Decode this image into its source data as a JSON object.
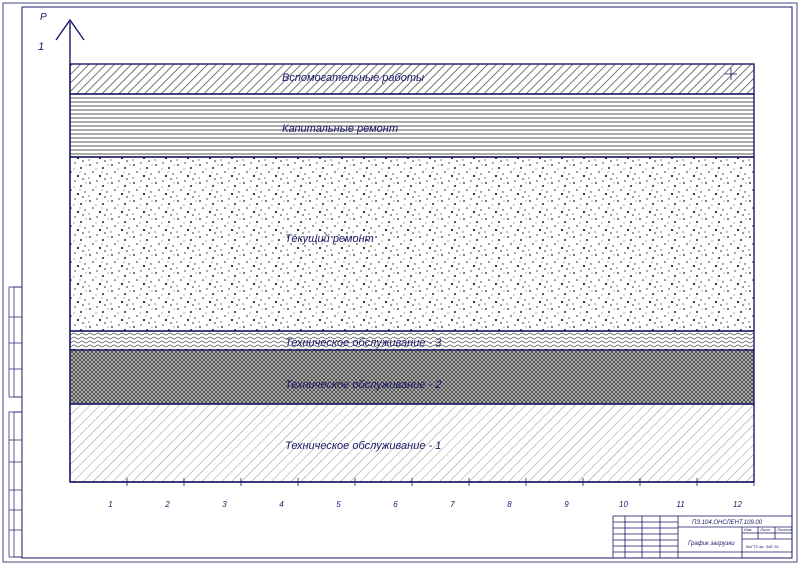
{
  "axis": {
    "y_symbol": "Р",
    "y_value": "1",
    "x_ticks": [
      "1",
      "2",
      "3",
      "4",
      "5",
      "6",
      "7",
      "8",
      "9",
      "10",
      "11",
      "12"
    ]
  },
  "bands": [
    {
      "label": "Вспомогательные работы",
      "pattern": "diag-dense"
    },
    {
      "label": "Капитальные ремонт",
      "pattern": "horizontal-lines"
    },
    {
      "label": "Текущий ремонт",
      "pattern": "speckle"
    },
    {
      "label": "Техническое обслуживание - 3",
      "pattern": "wavy"
    },
    {
      "label": "Техническое обслуживание - 2",
      "pattern": "crosshatch"
    },
    {
      "label": "Техническое обслуживание - 1",
      "pattern": "diag-sparse"
    }
  ],
  "title_block": {
    "doc_code": "ПЗ.104.ОНСЛЕНТ.109.00",
    "drawing_title": "График загрузки",
    "organization": "ВоГТУ гр. ЭАТ-51",
    "stage": "Изм.",
    "sheet": "Лист",
    "sheets": "Листов"
  },
  "colors": {
    "line": "#1a1a66",
    "paper": "#ffffff"
  }
}
